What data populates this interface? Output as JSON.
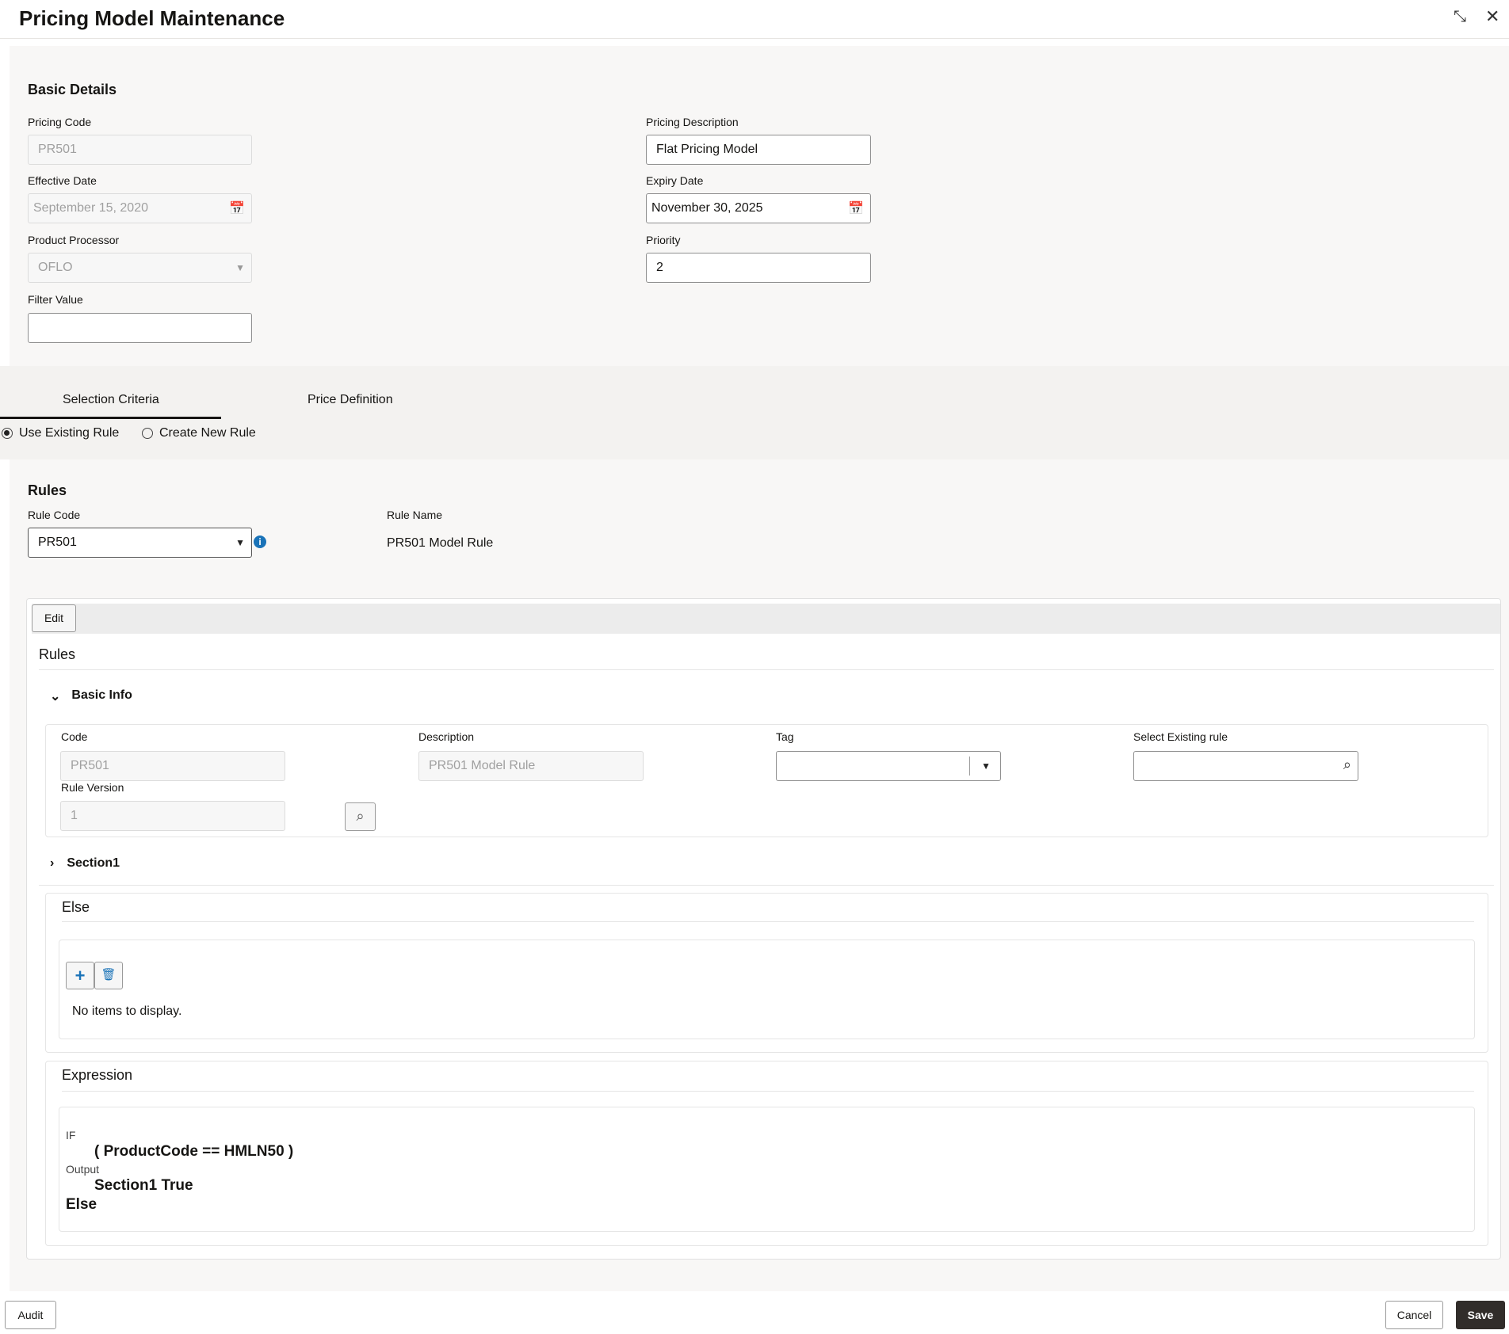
{
  "window": {
    "title": "Pricing Model Maintenance",
    "minimize_icon": "compress-icon",
    "close_icon": "close-icon"
  },
  "basic_details": {
    "heading": "Basic Details",
    "pricing_code": {
      "label": "Pricing Code",
      "value": "PR501"
    },
    "pricing_description": {
      "label": "Pricing Description",
      "value": "Flat Pricing Model"
    },
    "effective_date": {
      "label": "Effective Date",
      "value": "September 15, 2020"
    },
    "expiry_date": {
      "label": "Expiry Date",
      "value": "November 30, 2025"
    },
    "product_processor": {
      "label": "Product Processor",
      "value": "OFLO"
    },
    "priority": {
      "label": "Priority",
      "value": "2"
    },
    "filter_value": {
      "label": "Filter Value",
      "value": ""
    }
  },
  "tabs": [
    {
      "label": "Selection Criteria",
      "active": true
    },
    {
      "label": "Price Definition",
      "active": false
    }
  ],
  "rule_mode": {
    "options": [
      {
        "label": "Use Existing Rule",
        "selected": true
      },
      {
        "label": "Create New Rule",
        "selected": false
      }
    ]
  },
  "rules": {
    "heading": "Rules",
    "rule_code": {
      "label": "Rule Code",
      "value": "PR501"
    },
    "rule_name": {
      "label": "Rule Name",
      "value": "PR501 Model Rule"
    }
  },
  "rule_editor": {
    "edit_label": "Edit",
    "heading": "Rules",
    "basic_info": {
      "heading": "Basic Info",
      "code": {
        "label": "Code",
        "value": "PR501"
      },
      "description": {
        "label": "Description",
        "value": "PR501 Model Rule"
      },
      "tag": {
        "label": "Tag",
        "value": ""
      },
      "select_existing_rule": {
        "label": "Select Existing rule",
        "value": ""
      },
      "rule_version": {
        "label": "Rule Version",
        "value": "1"
      }
    },
    "section1": {
      "heading": "Section1"
    },
    "else": {
      "heading": "Else",
      "empty_text": "No items to display."
    },
    "expression": {
      "heading": "Expression",
      "if_label": "IF",
      "condition": "( ProductCode == HMLN50 )",
      "output_label": "Output",
      "output_value": "Section1 True",
      "else_label": "Else"
    }
  },
  "footer": {
    "audit": "Audit",
    "cancel": "Cancel",
    "save": "Save"
  },
  "colors": {
    "accent": "#1a73b8",
    "save_bg": "#312d2a"
  }
}
